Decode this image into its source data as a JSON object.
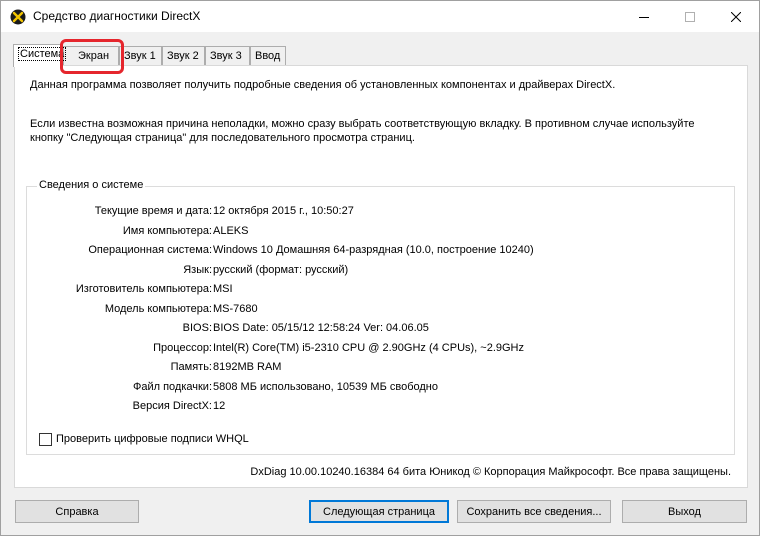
{
  "window": {
    "title": "Средство диагностики DirectX",
    "controls": {
      "minimize": "—",
      "maximize": "☐",
      "close": "✕"
    }
  },
  "tabs": [
    {
      "label": "Система",
      "active": true
    },
    {
      "label": "Экран",
      "highlighted": true
    },
    {
      "label": "Звук 1"
    },
    {
      "label": "Звук 2"
    },
    {
      "label": "Звук 3"
    },
    {
      "label": "Ввод"
    }
  ],
  "intro": {
    "line1": "Данная программа позволяет получить подробные сведения об установленных компонентах и драйверах DirectX.",
    "line2": "Если известна возможная причина неполадки, можно сразу выбрать соответствующую вкладку. В противном случае используйте кнопку \"Следующая страница\" для последовательного просмотра страниц."
  },
  "system_info": {
    "title": "Сведения о системе",
    "rows": [
      {
        "label": "Текущие время и дата:",
        "value": "12 октября 2015 г., 10:50:27"
      },
      {
        "label": "Имя компьютера:",
        "value": "ALEKS"
      },
      {
        "label": "Операционная система:",
        "value": "Windows 10 Домашняя 64-разрядная (10.0, построение 10240)"
      },
      {
        "label": "Язык:",
        "value": "русский (формат: русский)"
      },
      {
        "label": "Изготовитель компьютера:",
        "value": "MSI"
      },
      {
        "label": "Модель компьютера:",
        "value": "MS-7680"
      },
      {
        "label": "BIOS:",
        "value": "BIOS Date: 05/15/12 12:58:24 Ver: 04.06.05"
      },
      {
        "label": "Процессор:",
        "value": "Intel(R) Core(TM) i5-2310 CPU @ 2.90GHz (4 CPUs), ~2.9GHz"
      },
      {
        "label": "Память:",
        "value": "8192MB RAM"
      },
      {
        "label": "Файл подкачки:",
        "value": "5808 МБ использовано, 10539 МБ свободно"
      },
      {
        "label": "Версия DirectX:",
        "value": "12"
      }
    ]
  },
  "whql_checkbox": {
    "label": "Проверить цифровые подписи WHQL",
    "checked": false
  },
  "footer": "DxDiag 10.00.10240.16384 64 бита Юникод © Корпорация Майкрософт. Все права защищены.",
  "buttons": {
    "help": "Справка",
    "next": "Следующая страница",
    "save": "Сохранить все сведения...",
    "exit": "Выход"
  },
  "colors": {
    "highlight": "#e5262d",
    "focus": "#0078d7"
  }
}
